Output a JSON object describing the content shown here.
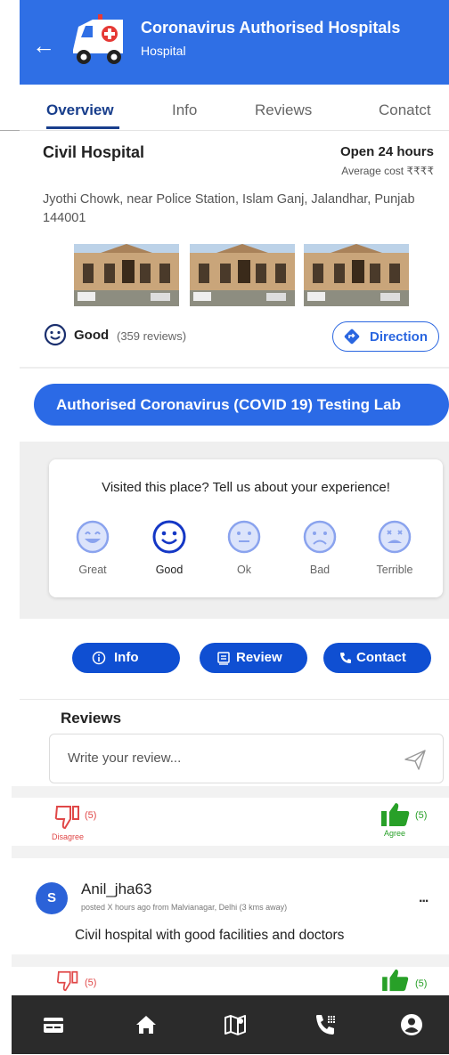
{
  "header": {
    "title": "Coronavirus Authorised Hospitals",
    "subtitle": "Hospital",
    "brand_color": "#2f6fe5"
  },
  "tabs": [
    {
      "label": "Overview",
      "active": true
    },
    {
      "label": "Info",
      "active": false
    },
    {
      "label": "Reviews",
      "active": false
    },
    {
      "label": "Conatct",
      "active": false
    }
  ],
  "hospital": {
    "name": "Civil Hospital",
    "hours": "Open 24 hours",
    "average_cost": "Average cost ₹₹₹₹",
    "address": "Jyothi Chowk, near Police Station, Islam Ganj, Jalandhar, Punjab 144001"
  },
  "rating": {
    "label": "Good",
    "count": "(359 reviews)",
    "direction_label": "Direction"
  },
  "covid_button": "Authorised Coronavirus (COVID 19) Testing Lab",
  "experience": {
    "question": "Visited this place? Tell us about your experience!",
    "options": [
      "Great",
      "Good",
      "Ok",
      "Bad",
      "Terrible"
    ],
    "selected": "Good"
  },
  "actions": {
    "info": "Info",
    "review": "Review",
    "contact": "Contact"
  },
  "reviews": {
    "heading": "Reviews",
    "input_placeholder": "Write your review...",
    "vote_rows": [
      {
        "disagree_count": "(5)",
        "agree_count": "(5)",
        "disagree_label": "Disagree",
        "agree_label": "Agree"
      },
      {
        "disagree_count": "(5)",
        "agree_count": "(5)"
      }
    ],
    "items": [
      {
        "avatar_letter": "S",
        "user": "Anil_jha63",
        "posted": "posted X hours ago from Malvianagar, Delhi (3 kms away)",
        "more": "...",
        "comment": "Civil hospital with good facilities and doctors"
      }
    ]
  },
  "bottom_nav": [
    "card-icon",
    "home-icon",
    "map-icon",
    "phone-icon",
    "profile-icon"
  ]
}
